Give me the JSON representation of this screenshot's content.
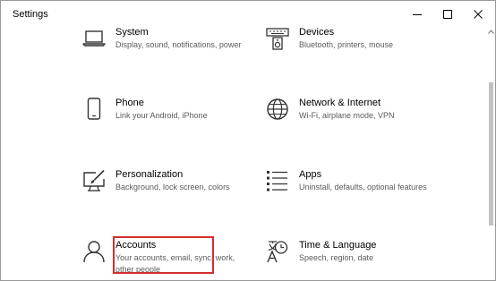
{
  "window": {
    "title": "Settings"
  },
  "tiles": [
    {
      "id": "system",
      "label": "System",
      "description": "Display, sound, notifications, power",
      "icon": "laptop-icon"
    },
    {
      "id": "devices",
      "label": "Devices",
      "description": "Bluetooth, printers, mouse",
      "icon": "keyboard-speaker-icon"
    },
    {
      "id": "phone",
      "label": "Phone",
      "description": "Link your Android, iPhone",
      "icon": "phone-icon"
    },
    {
      "id": "network",
      "label": "Network & Internet",
      "description": "Wi-Fi, airplane mode, VPN",
      "icon": "globe-icon"
    },
    {
      "id": "personalization",
      "label": "Personalization",
      "description": "Background, lock screen, colors",
      "icon": "paint-icon"
    },
    {
      "id": "apps",
      "label": "Apps",
      "description": "Uninstall, defaults, optional features",
      "icon": "apps-list-icon"
    },
    {
      "id": "accounts",
      "label": "Accounts",
      "description": "Your accounts, email, sync, work, other people",
      "icon": "person-icon"
    },
    {
      "id": "time-language",
      "label": "Time & Language",
      "description": "Speech, region, date",
      "icon": "time-language-icon"
    }
  ],
  "highlight": {
    "target": "accounts",
    "color": "#d32f2f"
  },
  "colors": {
    "text": "#000000",
    "description": "#5b5b5b",
    "icon": "#333333"
  }
}
